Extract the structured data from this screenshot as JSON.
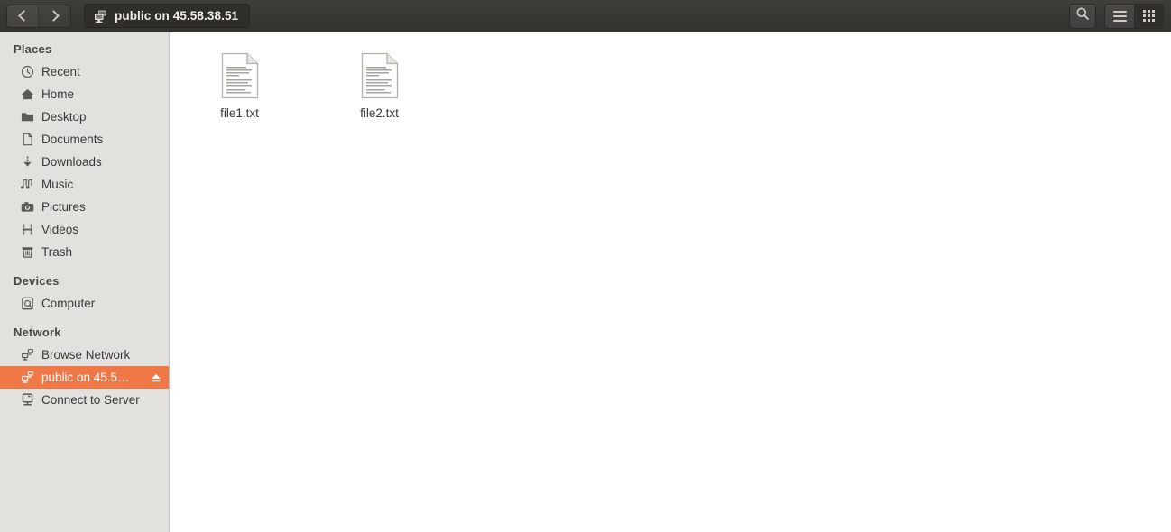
{
  "window": {
    "title": "public on 45.58.38.51"
  },
  "header": {
    "back_label": "Back",
    "forward_label": "Forward",
    "path_label": "public on 45.58.38.51",
    "search_label": "Search",
    "menu_label": "Menu",
    "view_grid_label": "View options"
  },
  "sidebar": {
    "sections": [
      {
        "title": "Places",
        "items": [
          {
            "label": "Recent",
            "icon": "clock-icon"
          },
          {
            "label": "Home",
            "icon": "home-icon"
          },
          {
            "label": "Desktop",
            "icon": "folder-icon"
          },
          {
            "label": "Documents",
            "icon": "document-icon"
          },
          {
            "label": "Downloads",
            "icon": "download-icon"
          },
          {
            "label": "Music",
            "icon": "music-note-icon"
          },
          {
            "label": "Pictures",
            "icon": "camera-icon"
          },
          {
            "label": "Videos",
            "icon": "film-icon"
          },
          {
            "label": "Trash",
            "icon": "trash-icon"
          }
        ]
      },
      {
        "title": "Devices",
        "items": [
          {
            "label": "Computer",
            "icon": "computer-disk-icon"
          }
        ]
      },
      {
        "title": "Network",
        "items": [
          {
            "label": "Browse Network",
            "icon": "network-workgroup-icon"
          },
          {
            "label": "public on 45.5…",
            "icon": "network-share-icon",
            "selected": true,
            "eject": true
          },
          {
            "label": "Connect to Server",
            "icon": "server-icon"
          }
        ]
      }
    ]
  },
  "files": [
    {
      "name": "file1.txt",
      "icon": "text-file-icon"
    },
    {
      "name": "file2.txt",
      "icon": "text-file-icon"
    }
  ],
  "colors": {
    "selection": "#f07746",
    "headerbar": "#393733",
    "sidebar_bg": "#e3e1de",
    "content_bg": "#ffffff",
    "text": "#3b3a38"
  }
}
